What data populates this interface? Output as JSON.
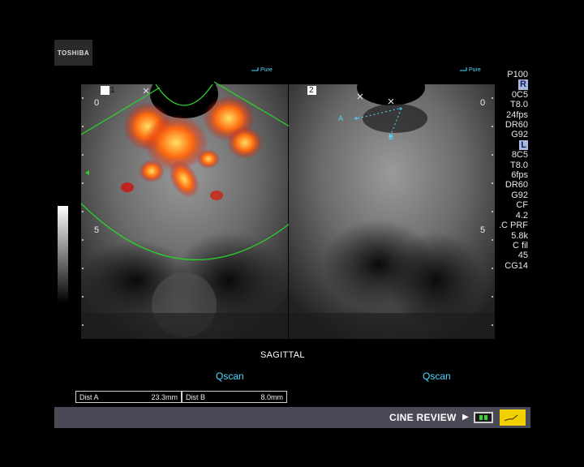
{
  "brand": {
    "logo": "TOSHIBA"
  },
  "panel_left": {
    "index_label": "1",
    "depth_top": "0",
    "depth_mid": "5",
    "preset_tag": "Pure"
  },
  "panel_right": {
    "index_label": "2",
    "depth_top": "0",
    "depth_mid": "5",
    "preset_tag": "Pure",
    "caliper_a": "A",
    "caliper_b": "B"
  },
  "params": [
    "P100",
    "R",
    "0C5",
    "T8.0",
    "24fps",
    "DR60",
    "G92",
    "L",
    "8C5",
    "T8.0",
    "6fps",
    "DR60",
    "G92",
    "CF",
    "4.2",
    ".C PRF",
    "5.8k",
    "C fil",
    "45",
    "CG14"
  ],
  "bottom": {
    "plane": "SAGITTAL",
    "left_mode": "Qscan",
    "right_mode": "Qscan"
  },
  "measurements": [
    {
      "label": "Dist A",
      "value": "23.3mm"
    },
    {
      "label": "Dist B",
      "value": "8.0mm"
    }
  ],
  "status": {
    "cine": "CINE REVIEW"
  },
  "colors": {
    "cyan_text": "#4fd9ff",
    "green_sector": "#2bd02b",
    "status_bar": "#4a4a56",
    "doppler_hot": "#ff4a10"
  }
}
